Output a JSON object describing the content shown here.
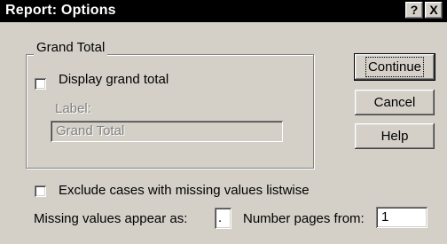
{
  "window": {
    "title": "Report: Options",
    "help_button": "?",
    "close_button": "X"
  },
  "group": {
    "title": "Grand Total",
    "display_grand_total": {
      "label": "Display grand total",
      "checked": false
    },
    "label_caption": "Label:",
    "label_value": "Grand Total"
  },
  "buttons": {
    "continue": "Continue",
    "cancel": "Cancel",
    "help": "Help"
  },
  "options": {
    "exclude_missing": {
      "label": "Exclude cases with missing values listwise",
      "checked": false
    },
    "missing_appear_label": "Missing values appear as:",
    "missing_appear_value": ".",
    "number_pages_label": "Number pages from:",
    "number_pages_value": "1"
  }
}
